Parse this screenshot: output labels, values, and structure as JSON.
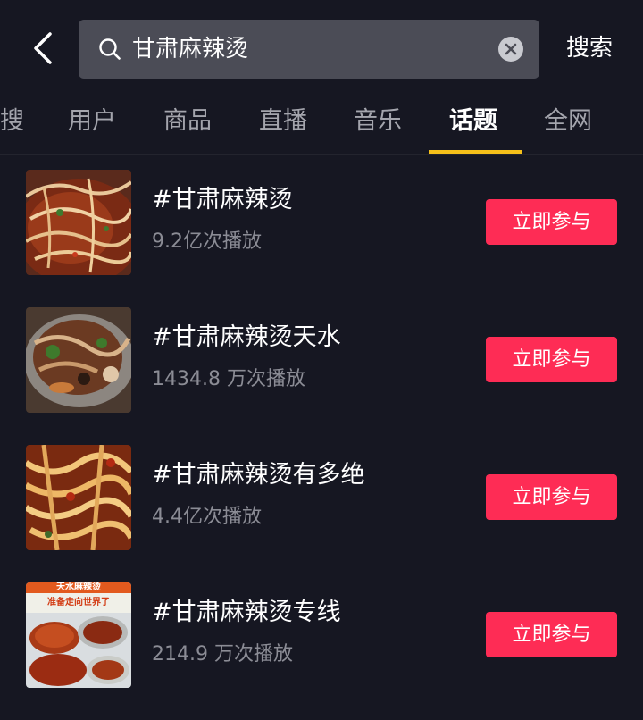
{
  "search": {
    "query": "甘肃麻辣烫",
    "submit_label": "搜索"
  },
  "tabs": [
    {
      "label": "搜"
    },
    {
      "label": "用户"
    },
    {
      "label": "商品"
    },
    {
      "label": "直播"
    },
    {
      "label": "音乐"
    },
    {
      "label": "话题",
      "active": true
    },
    {
      "label": "全网"
    }
  ],
  "topics": [
    {
      "title": "#甘肃麻辣烫",
      "plays": "9.2亿次播放",
      "button": "立即参与"
    },
    {
      "title": "#甘肃麻辣烫天水",
      "plays": "1434.8 万次播放",
      "button": "立即参与"
    },
    {
      "title": "#甘肃麻辣烫有多绝",
      "plays": "4.4亿次播放",
      "button": "立即参与"
    },
    {
      "title": "#甘肃麻辣烫专线",
      "plays": "214.9 万次播放",
      "button": "立即参与"
    }
  ],
  "thumbnail_overlay_lines": [
    "天水麻辣烫",
    "准备走向世界了"
  ],
  "colors": {
    "background": "#161722",
    "search_box": "#4b4c56",
    "accent_button": "#fe2c55",
    "tab_indicator": "#f5c01a",
    "muted_text": "#8b8c95"
  }
}
